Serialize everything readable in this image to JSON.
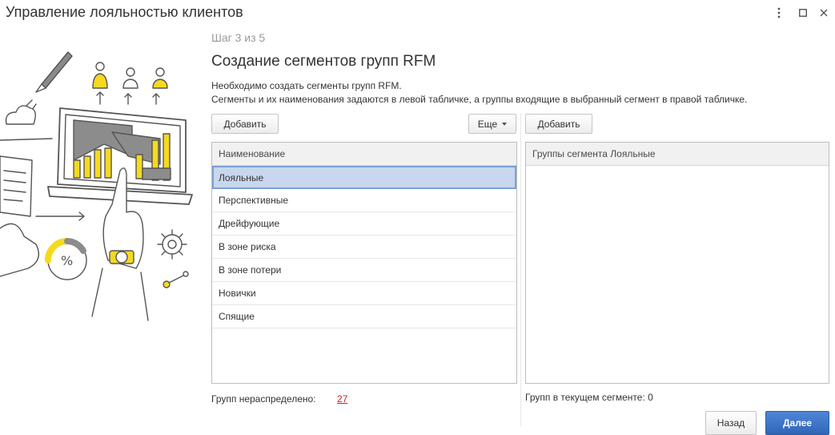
{
  "window": {
    "title": "Управление лояльностью клиентов"
  },
  "wizard": {
    "step": "Шаг 3 из 5",
    "title": "Создание сегментов групп RFM",
    "description": [
      "Необходимо создать сегменты групп RFM.",
      "Сегменты и их наименования задаются в левой табличке, а группы входящие в выбранный сегмент в правой табличке."
    ]
  },
  "left_panel": {
    "add_label": "Добавить",
    "more_label": "Еще",
    "column_header": "Наименование",
    "rows": [
      "Лояльные",
      "Перспективные",
      "Дрейфующие",
      "В зоне риска",
      "В зоне потери",
      "Новички",
      "Спящие"
    ],
    "selected_index": 0,
    "footer_label": "Групп нераспределено:",
    "footer_value": "27"
  },
  "right_panel": {
    "add_label": "Добавить",
    "column_header": "Группы сегмента Лояльные",
    "footer_label": "Групп в текущем сегменте: 0"
  },
  "navigation": {
    "back_label": "Назад",
    "next_label": "Далее"
  },
  "colors": {
    "accent_yellow": "#f6d91f",
    "selection": "#c8d7ee",
    "link_red": "#d21f1f",
    "primary_blue": "#2f66b9"
  },
  "icons": [
    "more-vertical-icon",
    "maximize-icon",
    "close-icon",
    "dropdown-caret-icon"
  ]
}
